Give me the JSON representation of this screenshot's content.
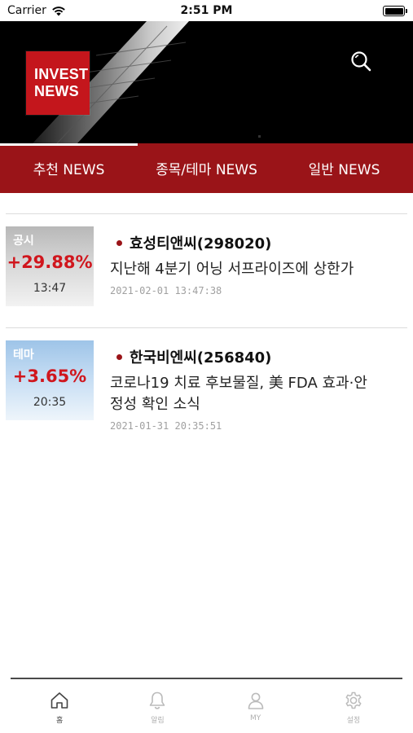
{
  "status_bar": {
    "carrier": "Carrier",
    "time": "2:51 PM",
    "battery_level": 1.0
  },
  "header": {
    "logo_line1": "INVEST",
    "logo_line2": "NEWS",
    "search_icon": "search-icon",
    "colors": {
      "brand_red": "#c4161c",
      "tab_red": "#9a1418"
    }
  },
  "tabs": [
    {
      "label": "추천 NEWS",
      "active": true
    },
    {
      "label": "종목/테마 NEWS",
      "active": false
    },
    {
      "label": "일반 NEWS",
      "active": false
    }
  ],
  "news": [
    {
      "type": "공시",
      "change": "+29.88%",
      "time": "13:47",
      "company": "효성티앤씨(298020)",
      "headline": "지난해 4분기 어닝 서프라이즈에 상한가",
      "datetime": "2021-02-01 13:47:38"
    },
    {
      "type": "테마",
      "change": "+3.65%",
      "time": "20:35",
      "company": "한국비엔씨(256840)",
      "headline": "코로나19 치료 후보물질, 美 FDA 효과·안정성 확인 소식",
      "datetime": "2021-01-31 20:35:51"
    }
  ],
  "tabbar": [
    {
      "label": "홈",
      "icon": "home-icon",
      "active": true
    },
    {
      "label": "알림",
      "icon": "bell-icon",
      "active": false
    },
    {
      "label": "MY",
      "icon": "person-icon",
      "active": false
    },
    {
      "label": "설정",
      "icon": "gear-icon",
      "active": false
    }
  ]
}
